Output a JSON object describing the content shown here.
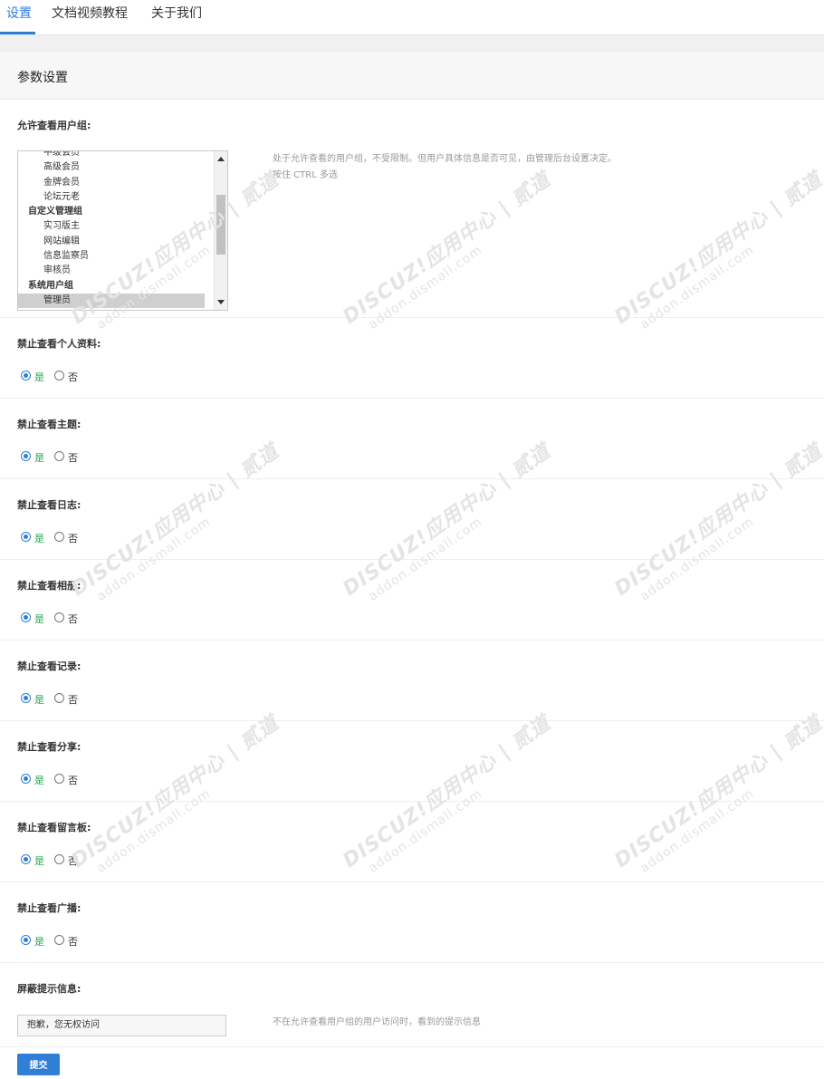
{
  "tabs": [
    {
      "label": "设置",
      "active": true
    },
    {
      "label": "文档视频教程",
      "active": false
    },
    {
      "label": "关于我们",
      "active": false
    }
  ],
  "panel_title": "参数设置",
  "usergroup": {
    "label": "允许查看用户组:",
    "options": [
      {
        "label": "中级会员",
        "group": false,
        "selected": false
      },
      {
        "label": "高级会员",
        "group": false,
        "selected": false
      },
      {
        "label": "金牌会员",
        "group": false,
        "selected": false
      },
      {
        "label": "论坛元老",
        "group": false,
        "selected": false
      },
      {
        "label": "自定义管理组",
        "group": true,
        "selected": false
      },
      {
        "label": "实习版主",
        "group": false,
        "selected": false
      },
      {
        "label": "网站编辑",
        "group": false,
        "selected": false
      },
      {
        "label": "信息监察员",
        "group": false,
        "selected": false
      },
      {
        "label": "审核员",
        "group": false,
        "selected": false
      },
      {
        "label": "系统用户组",
        "group": true,
        "selected": false
      },
      {
        "label": "管理员",
        "group": false,
        "selected": true
      }
    ],
    "help_line1": "处于允许查看的用户组，不受限制。但用户具体信息是否可见，由管理后台设置决定。",
    "help_line2": "按住 CTRL 多选"
  },
  "radio_yes": "是",
  "radio_no": "否",
  "settings": [
    {
      "label": "禁止查看个人资料:",
      "value": "yes"
    },
    {
      "label": "禁止查看主题:",
      "value": "yes"
    },
    {
      "label": "禁止查看日志:",
      "value": "yes"
    },
    {
      "label": "禁止查看相册:",
      "value": "yes"
    },
    {
      "label": "禁止查看记录:",
      "value": "yes"
    },
    {
      "label": "禁止查看分享:",
      "value": "yes"
    },
    {
      "label": "禁止查看留言板:",
      "value": "yes"
    },
    {
      "label": "禁止查看广播:",
      "value": "yes"
    }
  ],
  "blocked_msg": {
    "label": "屏蔽提示信息:",
    "value": "抱歉，您无权访问",
    "help": "不在允许查看用户组的用户访问时，看到的提示信息"
  },
  "submit_label": "提交",
  "watermark": {
    "line1": "DISCUZ!应用中心 | 贰道",
    "line2": "addon.dismall.com"
  }
}
